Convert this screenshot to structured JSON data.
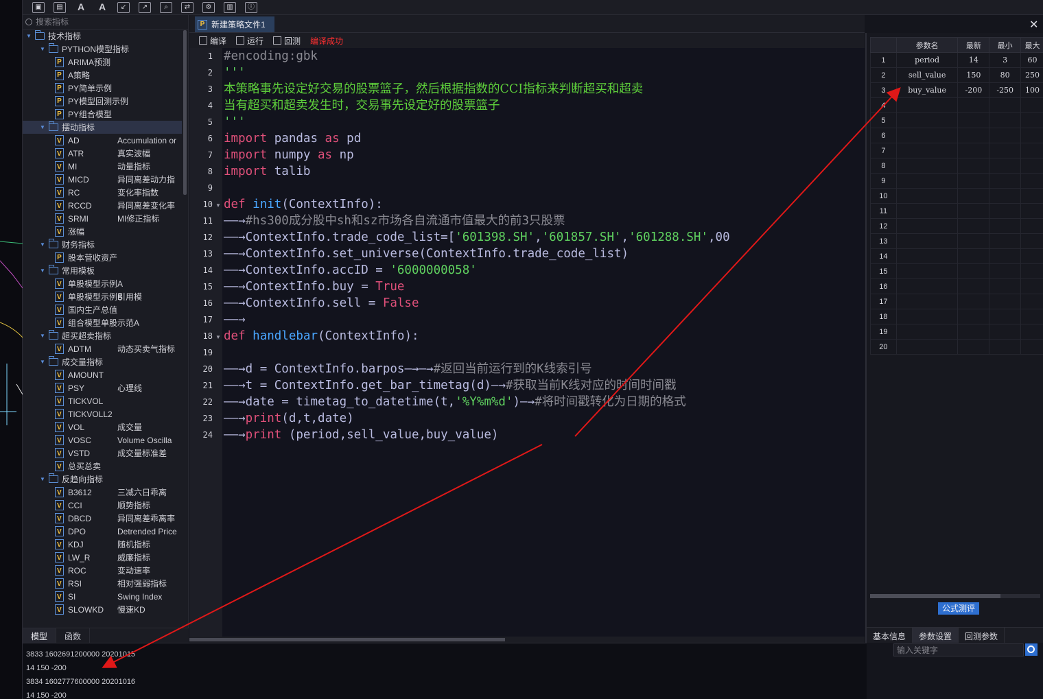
{
  "toolbar": {
    "icons": [
      "save-icon",
      "save-as-icon",
      "font-decrease-icon",
      "font-increase-icon",
      "import-icon",
      "export-icon",
      "find-icon",
      "replace-icon",
      "settings-icon",
      "chart-icon",
      "info-icon"
    ],
    "font_dec": "A",
    "font_inc": "A"
  },
  "search": {
    "placeholder": "搜索指标"
  },
  "tree": [
    {
      "level": 0,
      "type": "folder",
      "open": true,
      "label": "技术指标"
    },
    {
      "level": 1,
      "type": "folder",
      "open": true,
      "label": "PYTHON模型指标"
    },
    {
      "level": 2,
      "type": "py",
      "label": "ARIMA预测",
      "desc": ""
    },
    {
      "level": 2,
      "type": "py",
      "label": "A策略",
      "desc": ""
    },
    {
      "level": 2,
      "type": "py",
      "label": "PY简单示例",
      "desc": ""
    },
    {
      "level": 2,
      "type": "py",
      "label": "PY模型回测示例",
      "desc": ""
    },
    {
      "level": 2,
      "type": "py",
      "label": "PY组合模型",
      "desc": ""
    },
    {
      "level": 1,
      "type": "folder",
      "open": true,
      "label": "摆动指标",
      "selected": true
    },
    {
      "level": 2,
      "type": "v",
      "label": "AD",
      "desc": "Accumulation or"
    },
    {
      "level": 2,
      "type": "v",
      "label": "ATR",
      "desc": "真实波幅"
    },
    {
      "level": 2,
      "type": "v",
      "label": "MI",
      "desc": "动量指标"
    },
    {
      "level": 2,
      "type": "v",
      "label": "MICD",
      "desc": "异同离差动力指"
    },
    {
      "level": 2,
      "type": "v",
      "label": "RC",
      "desc": "变化率指数"
    },
    {
      "level": 2,
      "type": "v",
      "label": "RCCD",
      "desc": "异同离差变化率"
    },
    {
      "level": 2,
      "type": "v",
      "label": "SRMI",
      "desc": "MI修正指标"
    },
    {
      "level": 2,
      "type": "v",
      "label": "涨幅",
      "desc": ""
    },
    {
      "level": 1,
      "type": "folder",
      "open": true,
      "label": "财务指标"
    },
    {
      "level": 2,
      "type": "py",
      "label": "股本营收资产",
      "desc": ""
    },
    {
      "level": 1,
      "type": "folder",
      "open": true,
      "label": "常用模板"
    },
    {
      "level": 2,
      "type": "v",
      "label": "单股模型示例A",
      "desc": ""
    },
    {
      "level": 2,
      "type": "v",
      "label": "单股模型示例B",
      "desc": "引用模"
    },
    {
      "level": 2,
      "type": "v",
      "label": "国内生产总值",
      "desc": ""
    },
    {
      "level": 2,
      "type": "v",
      "label": "组合模型单股示范A",
      "desc": ""
    },
    {
      "level": 1,
      "type": "folder",
      "open": true,
      "label": "超买超卖指标"
    },
    {
      "level": 2,
      "type": "v",
      "label": "ADTM",
      "desc": "动态买卖气指标"
    },
    {
      "level": 1,
      "type": "folder",
      "open": true,
      "label": "成交量指标"
    },
    {
      "level": 2,
      "type": "v",
      "label": "AMOUNT",
      "desc": ""
    },
    {
      "level": 2,
      "type": "v",
      "label": "PSY",
      "desc": "心理线"
    },
    {
      "level": 2,
      "type": "v",
      "label": "TICKVOL",
      "desc": ""
    },
    {
      "level": 2,
      "type": "v",
      "label": "TICKVOLL2",
      "desc": ""
    },
    {
      "level": 2,
      "type": "v",
      "label": "VOL",
      "desc": "成交量"
    },
    {
      "level": 2,
      "type": "v",
      "label": "VOSC",
      "desc": "Volume Oscilla"
    },
    {
      "level": 2,
      "type": "v",
      "label": "VSTD",
      "desc": "成交量标准差"
    },
    {
      "level": 2,
      "type": "v",
      "label": "总买总卖",
      "desc": ""
    },
    {
      "level": 1,
      "type": "folder",
      "open": true,
      "label": "反趋向指标"
    },
    {
      "level": 2,
      "type": "v",
      "label": "B3612",
      "desc": "三减六日乖离"
    },
    {
      "level": 2,
      "type": "v",
      "label": "CCI",
      "desc": "顺势指标"
    },
    {
      "level": 2,
      "type": "v",
      "label": "DBCD",
      "desc": "异同离差乖离率"
    },
    {
      "level": 2,
      "type": "v",
      "label": "DPO",
      "desc": "Detrended Price"
    },
    {
      "level": 2,
      "type": "v",
      "label": "KDJ",
      "desc": "随机指标"
    },
    {
      "level": 2,
      "type": "v",
      "label": "LW_R",
      "desc": "威廉指标"
    },
    {
      "level": 2,
      "type": "v",
      "label": "ROC",
      "desc": "变动速率"
    },
    {
      "level": 2,
      "type": "v",
      "label": "RSI",
      "desc": "相对强弱指标"
    },
    {
      "level": 2,
      "type": "v",
      "label": "SI",
      "desc": "Swing Index"
    },
    {
      "level": 2,
      "type": "v",
      "label": "SLOWKD",
      "desc": "慢速KD"
    }
  ],
  "left_tabs": [
    "模型",
    "函数"
  ],
  "editor": {
    "file_tab": "新建策略文件1",
    "compile_label": "编译",
    "run_label": "运行",
    "backtest_label": "回测",
    "status": "编译成功"
  },
  "code_lines": [
    "#encoding:gbk",
    "'''",
    "本策略事先设定好交易的股票篮子，然后根据指数的CCI指标来判断超买和超卖",
    "当有超买和超卖发生时，交易事先设定好的股票篮子",
    "'''",
    "import pandas as pd",
    "import numpy as np",
    "import talib",
    "",
    "def init(ContextInfo):",
    "→#hs300成分股中sh和sz市场各自流通市值最大的前3只股票",
    "→ContextInfo.trade_code_list=['601398.SH','601857.SH','601288.SH','00",
    "→ContextInfo.set_universe(ContextInfo.trade_code_list)",
    "→ContextInfo.accID = '6000000058'",
    "→ContextInfo.buy = True",
    "→ContextInfo.sell = False",
    "→",
    "def handlebar(ContextInfo):",
    "",
    "→d = ContextInfo.barpos→→#返回当前运行到的K线索引号",
    "→t = ContextInfo.get_bar_timetag(d)→#获取当前K线对应的时间时间戳",
    "→date = timetag_to_datetime(t,'%Y%m%d')→#将时间戳转化为日期的格式",
    "→print(d,t,date)",
    "→print (period,sell_value,buy_value)"
  ],
  "params": {
    "headers": [
      "",
      "参数名",
      "最新",
      "最小",
      "最大"
    ],
    "rows": [
      [
        "1",
        "period",
        "14",
        "3",
        "60"
      ],
      [
        "2",
        "sell_value",
        "150",
        "80",
        "250"
      ],
      [
        "3",
        "buy_value",
        "-200",
        "-250",
        "100"
      ]
    ],
    "empty_rows": [
      "4",
      "5",
      "6",
      "7",
      "8",
      "9",
      "10",
      "11",
      "12",
      "13",
      "14",
      "15",
      "16",
      "17",
      "18",
      "19",
      "20"
    ],
    "formula_button": "公式测评"
  },
  "right_tabs": [
    "基本信息",
    "参数设置",
    "回测参数"
  ],
  "right_tab_active": "参数设置",
  "keyword_search": {
    "placeholder": "输入关键字"
  },
  "output_lines": [
    "3833  1602691200000  20201015",
    "14  150  -200",
    "3834  1602777600000  20201016",
    "14  150  -200"
  ],
  "colors": {
    "annotation_arrow": "#e01818",
    "accent": "#2e6fd0",
    "status_error_red": "#ff3030",
    "keyword": "#e0507a",
    "function": "#4aa6ff",
    "string": "#5fd05f"
  }
}
